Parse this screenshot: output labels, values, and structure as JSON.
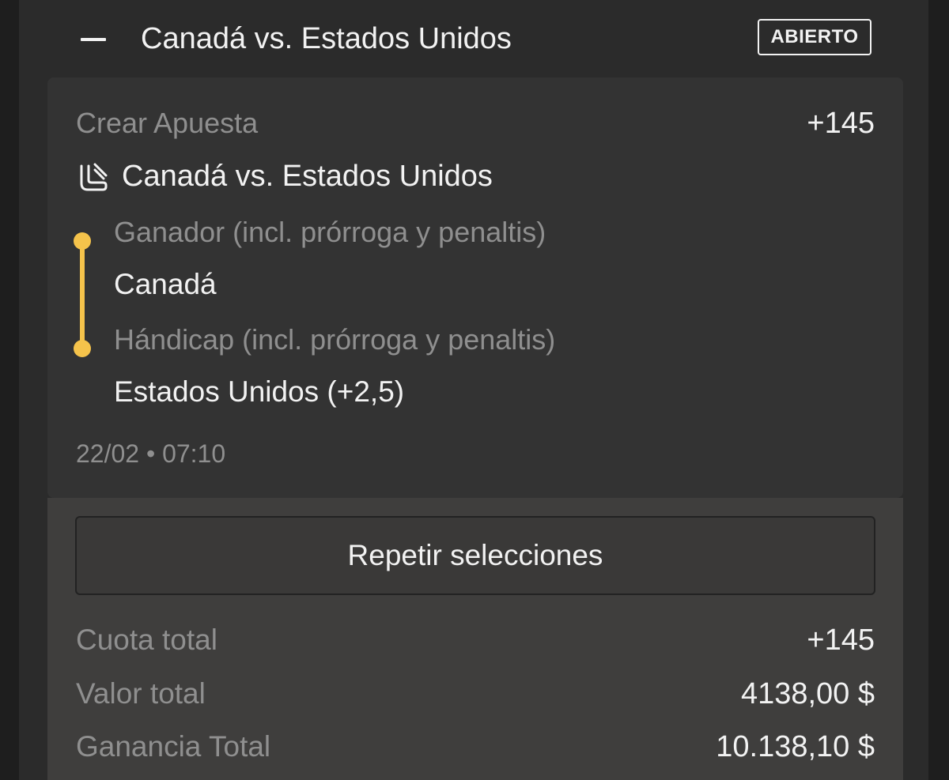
{
  "header": {
    "collapse_icon": "minus-icon",
    "title": "Canadá vs. Estados Unidos",
    "status": "ABIERTO"
  },
  "bet": {
    "type_label": "Crear Apuesta",
    "odds": "+145",
    "sport_icon": "ice-hockey-icon",
    "event": "Canadá vs. Estados Unidos",
    "accent_color": "#f5c34b",
    "legs": [
      {
        "market": "Ganador (incl. prórroga y penaltis)",
        "selection": "Canadá"
      },
      {
        "market": "Hándicap (incl. prórroga y penaltis)",
        "selection": "Estados Unidos (+2,5)"
      }
    ],
    "datetime": "22/02 • 07:10"
  },
  "actions": {
    "repeat_label": "Repetir selecciones"
  },
  "summary": [
    {
      "label": "Cuota total",
      "value": "+145"
    },
    {
      "label": "Valor total",
      "value": "4138,00 $"
    },
    {
      "label": "Ganancia Total",
      "value": "10.138,10 $"
    }
  ]
}
